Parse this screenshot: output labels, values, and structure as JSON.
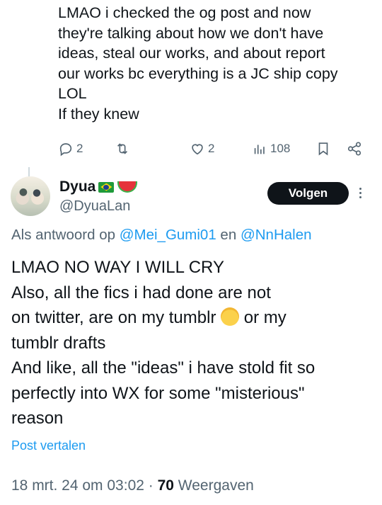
{
  "previous_tweet": {
    "text": "LMAO i checked the og post and now\nthey're talking about how we don't have\nideas, steal our works, and about report\nour works bc everything is a JC ship copy\nLOL\nIf they knew",
    "actions": {
      "replies": "2",
      "retweets": "",
      "likes": "2",
      "views": "108"
    }
  },
  "tweet": {
    "author_name": "Dyua",
    "author_handle": "@DyuaLan",
    "follow_label": "Volgen",
    "reply_prefix": "Als antwoord op ",
    "reply_user1": "@Mei_Gumi01",
    "reply_and": " en ",
    "reply_user2": "@NnHalen",
    "text_before_emoji": "LMAO NO WAY I WILL CRY\nAlso, all the fics i had done are not\non twitter, are on my tumblr ",
    "text_after_emoji": " or my\ntumblr drafts\nAnd like, all the \"ideas\" i have stold fit so\nperfectly into WX for some \"misterious\"\nreason",
    "translate_label": "Post vertalen",
    "date": "18 mrt. 24 om 03:02",
    "separator": " · ",
    "views_count": "70",
    "views_label": " Weergaven"
  },
  "colors": {
    "accent": "#1d9bf0",
    "muted": "#536471",
    "text": "#0f1419"
  }
}
